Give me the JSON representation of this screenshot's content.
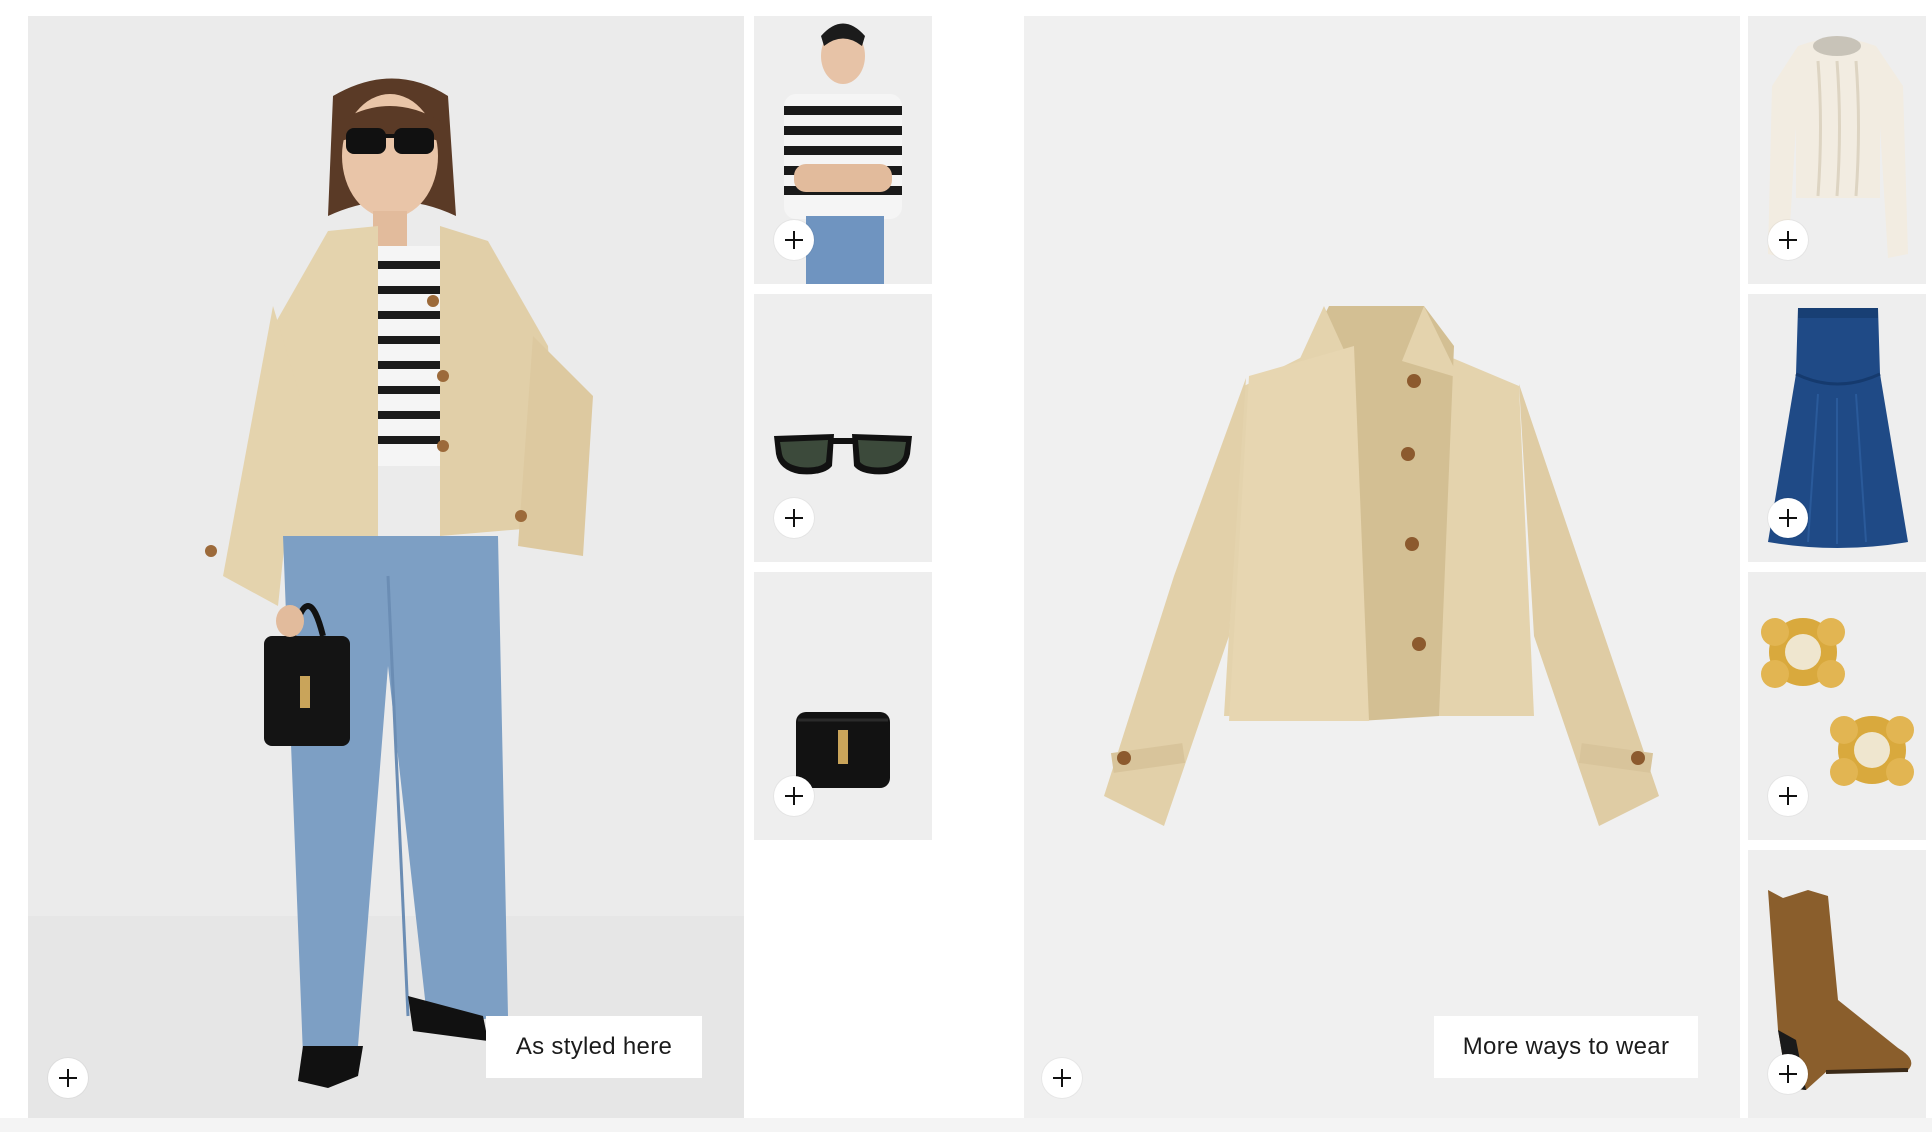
{
  "looks": {
    "styled": {
      "label": "As styled here",
      "main_image": "model-wearing-cropped-trench-jacket",
      "add_icon": "plus-icon",
      "items": [
        {
          "image": "striped-tee"
        },
        {
          "image": "black-sunglasses"
        },
        {
          "image": "black-shoulder-bag"
        }
      ]
    },
    "more": {
      "label": "More ways to wear",
      "main_image": "cropped-trench-jacket-flat",
      "add_icon": "plus-icon",
      "items": [
        {
          "image": "cream-cable-knit-sweater"
        },
        {
          "image": "denim-midi-skirt"
        },
        {
          "image": "gold-flower-earrings"
        },
        {
          "image": "suede-cowboy-boots"
        }
      ]
    }
  },
  "colors": {
    "panel_bg": "#ededed",
    "jacket": "#e4d3ad",
    "denim": "#7d9fc4",
    "dark_denim": "#1f4a86"
  }
}
